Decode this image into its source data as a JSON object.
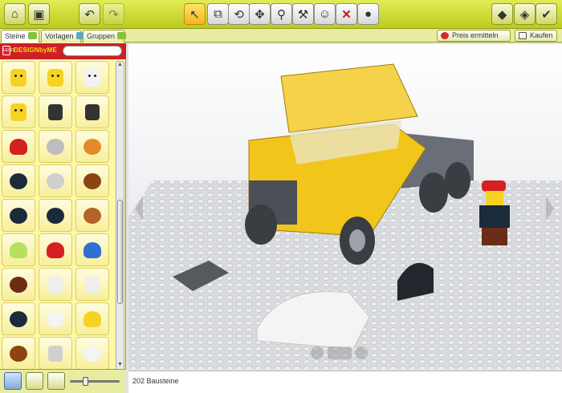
{
  "toolbar": {
    "left_buttons": [
      {
        "icon": "home-icon"
      },
      {
        "icon": "save-icon"
      },
      {
        "icon": "undo-icon"
      },
      {
        "icon": "redo-icon"
      }
    ],
    "tools": [
      {
        "icon": "select-cursor-icon"
      },
      {
        "icon": "clone-brick-icon"
      },
      {
        "icon": "hinge-tool-icon"
      },
      {
        "icon": "flex-tool-icon"
      },
      {
        "icon": "paint-bucket-icon"
      },
      {
        "icon": "hammer-delete-icon"
      },
      {
        "icon": "minifig-face-icon"
      },
      {
        "icon": "delete-x-icon"
      },
      {
        "icon": "paint-brush-icon"
      }
    ],
    "right_buttons": [
      {
        "icon": "build-mode-icon"
      },
      {
        "icon": "view-mode-icon"
      },
      {
        "icon": "building-guide-icon"
      }
    ]
  },
  "palette": {
    "tabs": [
      {
        "label": "Steine",
        "selected": true
      },
      {
        "label": "Vorlagen",
        "selected": false
      },
      {
        "label": "Gruppen",
        "selected": false
      }
    ],
    "brand": "DESIGNbyME",
    "search": {
      "value": "",
      "placeholder": ""
    },
    "items": [
      {
        "kind": "face",
        "color": "#f6d223"
      },
      {
        "kind": "face",
        "color": "#f6d223"
      },
      {
        "kind": "face",
        "color": "#f2f2f2"
      },
      {
        "kind": "face",
        "color": "#f6d223"
      },
      {
        "kind": "hand",
        "color": "#333333"
      },
      {
        "kind": "hand",
        "color": "#333333"
      },
      {
        "kind": "cap",
        "color": "#d42020"
      },
      {
        "kind": "helmet",
        "color": "#bdbdbd"
      },
      {
        "kind": "hair",
        "color": "#e6892c"
      },
      {
        "kind": "helmet",
        "color": "#1c2b3a"
      },
      {
        "kind": "helmet",
        "color": "#cfcfcf"
      },
      {
        "kind": "hair",
        "color": "#8b4513"
      },
      {
        "kind": "helmet",
        "color": "#1c2b3a"
      },
      {
        "kind": "helmet",
        "color": "#1c2b3a"
      },
      {
        "kind": "hair",
        "color": "#b5622a"
      },
      {
        "kind": "cap",
        "color": "#b7e060"
      },
      {
        "kind": "cap",
        "color": "#d42020"
      },
      {
        "kind": "cap",
        "color": "#2f6fd1"
      },
      {
        "kind": "beard",
        "color": "#6b2d15"
      },
      {
        "kind": "glasses",
        "color": "#eeeeee"
      },
      {
        "kind": "hand",
        "color": "#eeeeee"
      },
      {
        "kind": "helmet",
        "color": "#1c2b3a"
      },
      {
        "kind": "helmet",
        "color": "#f4f4f4"
      },
      {
        "kind": "cap",
        "color": "#f6d223"
      },
      {
        "kind": "hair",
        "color": "#8b4513"
      },
      {
        "kind": "hand",
        "color": "#d0d0d0"
      },
      {
        "kind": "helmet",
        "color": "#f4f4f4"
      }
    ],
    "footer": [
      {
        "icon": "brick-view-icon",
        "selected": true
      },
      {
        "icon": "color-palette-icon",
        "selected": false
      },
      {
        "icon": "decoration-icon",
        "selected": false
      }
    ]
  },
  "right_top": {
    "price_label": "Preis ermitteln",
    "buy_label": "Kaufen"
  },
  "scene": {
    "colors": {
      "baseplate": "#d9dbde",
      "truck": "#f2c51a",
      "cab_glass": "#e8e4c0",
      "dark": "#4b4f56"
    }
  },
  "status": {
    "brick_count_text": "202 Bausteine"
  }
}
